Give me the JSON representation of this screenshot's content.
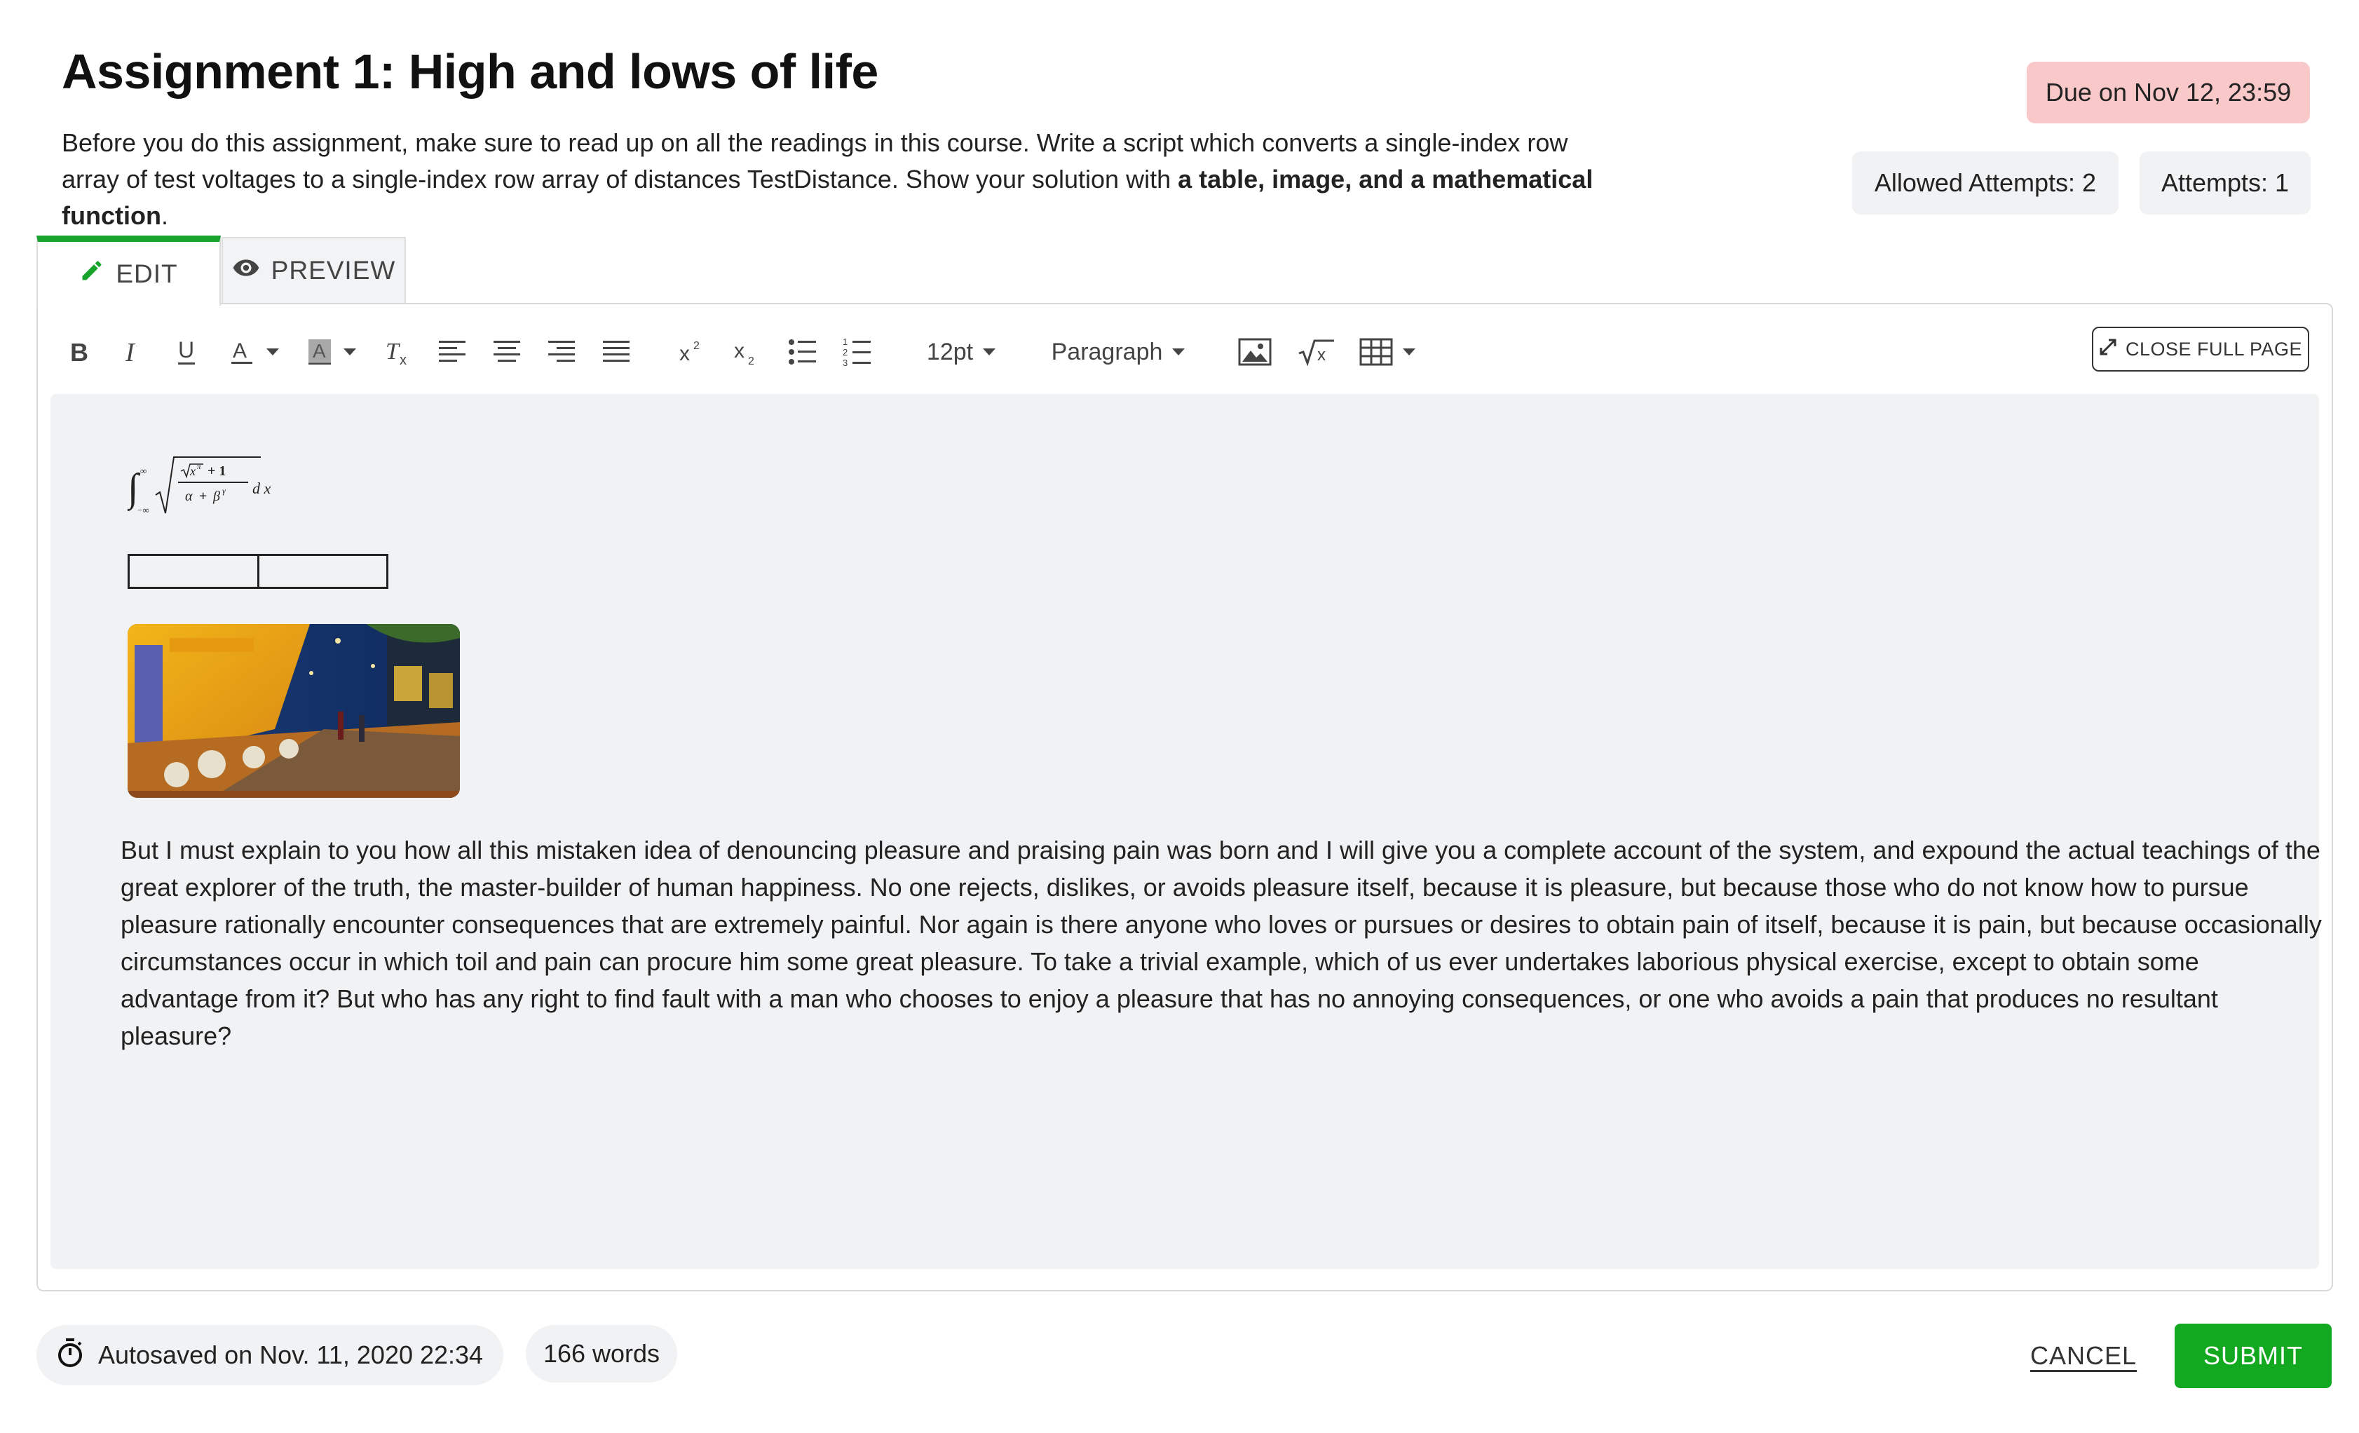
{
  "assignment": {
    "title": "Assignment 1: High and lows of life",
    "description_plain": "Before you do this assignment, make sure to read up on all the readings in this course. Write a script which converts a single-index row array of test voltages to a single-index row array of distances TestDistance. Show your solution with ",
    "description_bold": "a table, image, and a mathematical function",
    "description_end": ".",
    "due": "Due on Nov 12, 23:59",
    "allowed_attempts": "Allowed Attempts: 2",
    "attempts": "Attempts: 1"
  },
  "tabs": {
    "edit": "EDIT",
    "preview": "PREVIEW"
  },
  "toolbar": {
    "font_size": "12pt",
    "block_format": "Paragraph",
    "close_full_page": "CLOSE FULL PAGE",
    "icons": [
      "bold-icon",
      "italic-icon",
      "underline-icon",
      "text-color-icon",
      "highlight-color-icon",
      "clear-format-icon",
      "align-left-icon",
      "align-center-icon",
      "align-right-icon",
      "align-justify-icon",
      "superscript-icon",
      "subscript-icon",
      "bullet-list-icon",
      "numbered-list-icon",
      "image-icon",
      "math-icon",
      "table-icon"
    ]
  },
  "content": {
    "body_text": "But I must explain to you how all this mistaken idea of denouncing pleasure and praising pain was born and I will give you a complete account of the system, and expound the actual teachings of the great explorer of the truth, the master-builder of human happiness. No one rejects, dislikes, or avoids pleasure itself, because it is pleasure, but because those who do not know how to pursue pleasure rationally encounter consequences that are extremely painful. Nor again is there anyone who loves or pursues or desires to obtain pain of itself, because it is pain, but because occasionally circumstances occur in which toil and pain can procure him some great pleasure. To take a trivial example, which of us ever undertakes laborious physical exercise, except to obtain some advantage from it? But who has any right to find fault with a man who chooses to enjoy a pleasure that has no annoying consequences, or one who avoids a pain that produces no resultant pleasure?"
  },
  "footer": {
    "autosaved": "Autosaved on Nov. 11, 2020 22:34",
    "word_count": "166 words",
    "cancel": "CANCEL",
    "submit": "SUBMIT"
  },
  "colors": {
    "accent_green": "#12a81f",
    "due_badge_bg": "#f9c9c9",
    "content_bg": "#f1f2f4"
  }
}
